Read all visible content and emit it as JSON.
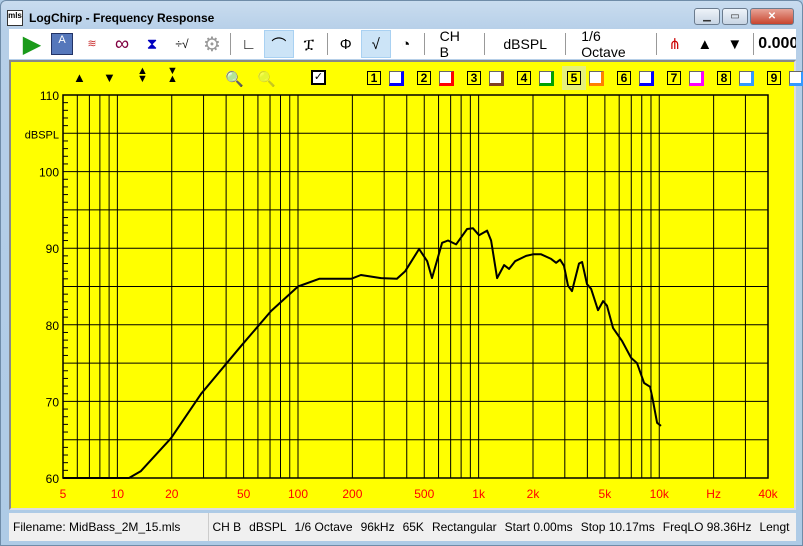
{
  "window": {
    "title": "LogChirp - Frequency Response",
    "icon_text": "mls"
  },
  "toolbar": {
    "channel": "CH B",
    "units": "dBSPL",
    "smoothing": "1/6 Octave",
    "value": "0.000",
    "icons": [
      "play-icon",
      "save-icon",
      "waterfall-icon",
      "loop-icon",
      "calibrate-icon",
      "math-icon",
      "settings-icon",
      "impulse-icon",
      "frequency-response-icon",
      "step-response-icon",
      "phase-icon",
      "group-delay-icon",
      "timer-icon",
      "marker-icon",
      "up-arrow-icon",
      "down-arrow-icon"
    ]
  },
  "plot_controls": {
    "channels": [
      "1",
      "2",
      "3",
      "4",
      "5",
      "6",
      "7",
      "8",
      "9"
    ],
    "channel_colors": [
      "#0000ff",
      "#0000ff",
      "#ff0000",
      "#804020",
      "#00a000",
      "#ff8000",
      "#0000ff",
      "#ff00ff",
      "#3399ff"
    ],
    "selected_channel": "5"
  },
  "status": {
    "filename": "Filename: MidBass_2M_15.mls",
    "items": [
      "CH B",
      "dBSPL",
      "1/6 Octave",
      "96kHz",
      "65K",
      "Rectangular",
      "Start 0.00ms",
      "Stop 10.17ms",
      "FreqLO 98.36Hz",
      "Lengt"
    ]
  },
  "chart_data": {
    "type": "line",
    "xscale": "log",
    "xlim": [
      5,
      40000
    ],
    "ylim": [
      60,
      110
    ],
    "grid": true,
    "ylabel": "dBSPL",
    "xunit": "Hz",
    "yticks": [
      "110",
      "100",
      "90",
      "80",
      "70",
      "60"
    ],
    "xticks": [
      {
        "v": 5,
        "l": "5"
      },
      {
        "v": 10,
        "l": "10"
      },
      {
        "v": 20,
        "l": "20"
      },
      {
        "v": 50,
        "l": "50"
      },
      {
        "v": 100,
        "l": "100"
      },
      {
        "v": 200,
        "l": "200"
      },
      {
        "v": 500,
        "l": "500"
      },
      {
        "v": 1000,
        "l": "1k"
      },
      {
        "v": 2000,
        "l": "2k"
      },
      {
        "v": 5000,
        "l": "5k"
      },
      {
        "v": 10000,
        "l": "10k"
      },
      {
        "v": 20000,
        "l": "Hz"
      },
      {
        "v": 40000,
        "l": "40k"
      }
    ],
    "colors": {
      "background": "#ffff00",
      "line": "#000000",
      "tick_labels_x": "#ff0000"
    },
    "x": [
      5,
      11.6,
      13.5,
      19.8,
      29.1,
      48.3,
      71,
      100,
      131,
      197,
      223,
      288,
      353,
      392,
      468,
      519,
      552,
      628,
      677,
      750,
      863,
      931,
      1005,
      1114,
      1172,
      1265,
      1384,
      1475,
      1592,
      1832,
      2000,
      2217,
      2518,
      2685,
      2824,
      2970,
      3125,
      3288,
      3596,
      3738,
      3980,
      4193,
      4583,
      4886,
      5140,
      5548,
      6223,
      6980,
      7533,
      8240,
      8895,
      9245,
      9726,
      10230
    ],
    "y": [
      60,
      60,
      60.9,
      65.2,
      71,
      77.2,
      81.8,
      85,
      86,
      86,
      86.5,
      86.1,
      86,
      87,
      89.9,
      88.3,
      86.1,
      90.7,
      91,
      90.5,
      92.5,
      92.6,
      91.7,
      92.3,
      91,
      86.1,
      87.8,
      87.3,
      88.3,
      89,
      89.2,
      89.2,
      88.6,
      88.1,
      88.5,
      87.7,
      85.1,
      84.4,
      88,
      88.2,
      85.3,
      84.7,
      81.9,
      83.1,
      82.5,
      79.6,
      77.9,
      75.7,
      75,
      72.4,
      71.9,
      70,
      67.2,
      66.8
    ]
  }
}
